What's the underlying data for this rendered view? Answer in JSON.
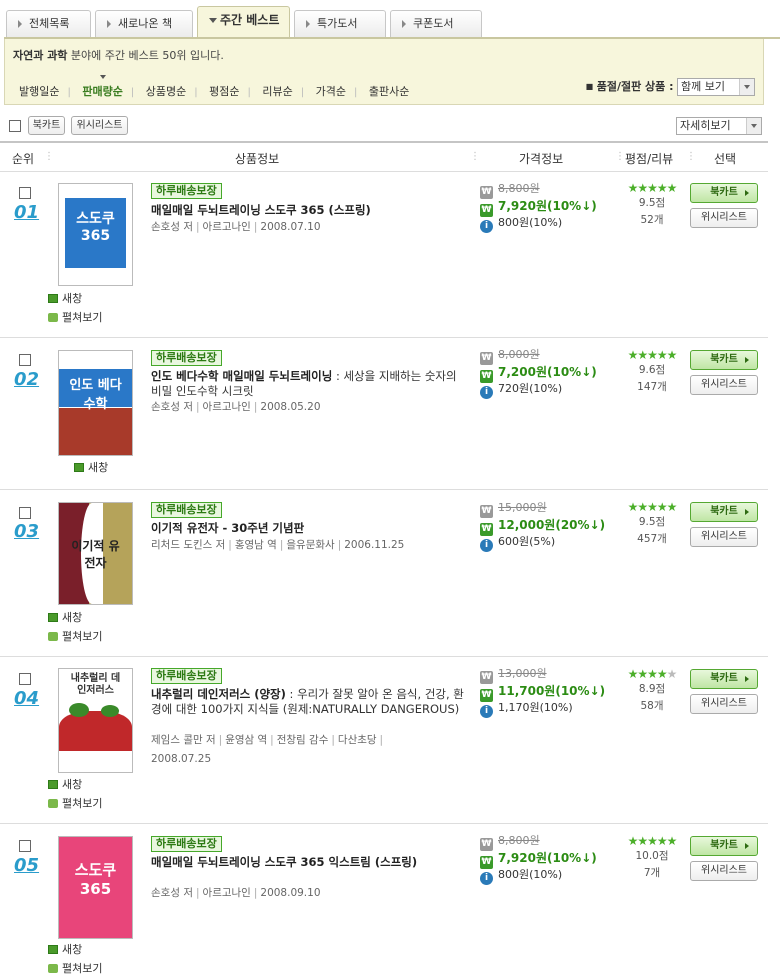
{
  "tabs": [
    {
      "label": "전체목록"
    },
    {
      "label": "새로나온 책"
    },
    {
      "label": "주간 베스트"
    },
    {
      "label": "특가도서"
    },
    {
      "label": "쿠폰도서"
    }
  ],
  "info": {
    "category": "자연과 과학",
    "desc": " 분야에 주간 베스트 50위 입니다."
  },
  "sorts": [
    "발행일순",
    "판매량순",
    "상품명순",
    "평점순",
    "리뷰순",
    "가격순",
    "출판사순"
  ],
  "filter": {
    "label": "품절/절판 상품 :",
    "value": "함께 보기"
  },
  "toolbar": {
    "cart": "북카트",
    "wish": "위시리스트",
    "view": "자세히보기"
  },
  "columns": {
    "rank": "순위",
    "product": "상품정보",
    "price": "가격정보",
    "rating": "평점/리뷰",
    "select": "선택"
  },
  "labels": {
    "new_window": "새창",
    "preview": "펼쳐보기",
    "badge": "하루배송보장",
    "cart": "북카트",
    "wish": "위시리스트"
  },
  "books": [
    {
      "rank": "01",
      "title": "매일매일 두뇌트레이닝 스도쿠 365 (스프링)",
      "subtitle": "",
      "meta": [
        "손호성 저",
        "아르고나인",
        "2008.07.10"
      ],
      "orig": "8,800원",
      "sale": "7,920원(10%↓)",
      "point": "800원(10%)",
      "stars": 5,
      "score": "9.5점",
      "reviews": "52개",
      "cover_text": "스도쿠 365",
      "cover_color": "#2a78c8"
    },
    {
      "rank": "02",
      "title": "인도 베다수학 매일매일 두뇌트레이닝",
      "subtitle": " : 세상을 지배하는 숫자의 비밀 인도수학 시크릿",
      "meta": [
        "손호성 저",
        "아르고나인",
        "2008.05.20"
      ],
      "orig": "8,000원",
      "sale": "7,200원(10%↓)",
      "point": "720원(10%)",
      "stars": 5,
      "score": "9.6점",
      "reviews": "147개",
      "cover_text": "인도 베다수학",
      "cover_color": "#2a78c8"
    },
    {
      "rank": "03",
      "title": "이기적 유전자 - 30주년 기념판",
      "subtitle": "",
      "meta": [
        "리처드 도킨스 저",
        "홍영남 역",
        "을유문화사",
        "2006.11.25"
      ],
      "orig": "15,000원",
      "sale": "12,000원(20%↓)",
      "point": "600원(5%)",
      "stars": 5,
      "score": "9.5점",
      "reviews": "457개",
      "cover_text": "이기적 유전자",
      "cover_color": "#7a1f2a"
    },
    {
      "rank": "04",
      "title": "내추럴리 데인저러스 (양장)",
      "subtitle": " : 우리가 잘못 알아 온 음식, 건강, 환경에 대한 100가지 지식들 (원제:NATURALLY DANGEROUS)",
      "meta": [
        "제임스 콜만 저",
        "윤영삼 역",
        "전창림 감수",
        "다산초당",
        "2008.07.25"
      ],
      "orig": "13,000원",
      "sale": "11,700원(10%↓)",
      "point": "1,170원(10%)",
      "stars": 4,
      "score": "8.9점",
      "reviews": "58개",
      "cover_text": "내추럴리 데인저러스",
      "cover_color": "#c0282a"
    },
    {
      "rank": "05",
      "title": "매일매일 두뇌트레이닝 스도쿠 365 익스트림 (스프링)",
      "subtitle": "",
      "meta": [
        "손호성 저",
        "아르고나인",
        "2008.09.10"
      ],
      "orig": "8,800원",
      "sale": "7,920원(10%↓)",
      "point": "800원(10%)",
      "stars": 5,
      "score": "10.0점",
      "reviews": "7개",
      "cover_text": "스도쿠 365",
      "cover_color": "#e8457a"
    }
  ]
}
